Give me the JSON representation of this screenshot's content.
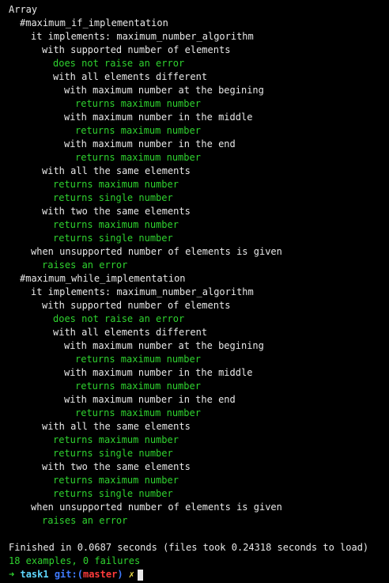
{
  "colors": {
    "background": "#000000",
    "text": "#e8e8e8",
    "pass": "#2fd32f",
    "prompt_dir": "#5fd7ff",
    "prompt_git": "#3f7bff",
    "prompt_branch": "#ff3b3b",
    "prompt_dirty": "#f2e24b"
  },
  "output": {
    "lines": [
      {
        "text": "Array",
        "indent": 0,
        "status": "group"
      },
      {
        "text": "#maximum_if_implementation",
        "indent": 1,
        "status": "group"
      },
      {
        "text": "it implements: maximum_number_algorithm",
        "indent": 2,
        "status": "group"
      },
      {
        "text": "with supported number of elements",
        "indent": 3,
        "status": "group"
      },
      {
        "text": "does not raise an error",
        "indent": 4,
        "status": "passed"
      },
      {
        "text": "with all elements different",
        "indent": 4,
        "status": "group"
      },
      {
        "text": "with maximum number at the begining",
        "indent": 5,
        "status": "group"
      },
      {
        "text": "returns maximum number",
        "indent": 6,
        "status": "passed"
      },
      {
        "text": "with maximum number in the middle",
        "indent": 5,
        "status": "group"
      },
      {
        "text": "returns maximum number",
        "indent": 6,
        "status": "passed"
      },
      {
        "text": "with maximum number in the end",
        "indent": 5,
        "status": "group"
      },
      {
        "text": "returns maximum number",
        "indent": 6,
        "status": "passed"
      },
      {
        "text": "with all the same elements",
        "indent": 3,
        "status": "group"
      },
      {
        "text": "returns maximum number",
        "indent": 4,
        "status": "passed"
      },
      {
        "text": "returns single number",
        "indent": 4,
        "status": "passed"
      },
      {
        "text": "with two the same elements",
        "indent": 3,
        "status": "group"
      },
      {
        "text": "returns maximum number",
        "indent": 4,
        "status": "passed"
      },
      {
        "text": "returns single number",
        "indent": 4,
        "status": "passed"
      },
      {
        "text": "when unsupported number of elements is given",
        "indent": 2,
        "status": "group"
      },
      {
        "text": "raises an error",
        "indent": 3,
        "status": "passed"
      },
      {
        "text": "#maximum_while_implementation",
        "indent": 1,
        "status": "group"
      },
      {
        "text": "it implements: maximum_number_algorithm",
        "indent": 2,
        "status": "group"
      },
      {
        "text": "with supported number of elements",
        "indent": 3,
        "status": "group"
      },
      {
        "text": "does not raise an error",
        "indent": 4,
        "status": "passed"
      },
      {
        "text": "with all elements different",
        "indent": 4,
        "status": "group"
      },
      {
        "text": "with maximum number at the begining",
        "indent": 5,
        "status": "group"
      },
      {
        "text": "returns maximum number",
        "indent": 6,
        "status": "passed"
      },
      {
        "text": "with maximum number in the middle",
        "indent": 5,
        "status": "group"
      },
      {
        "text": "returns maximum number",
        "indent": 6,
        "status": "passed"
      },
      {
        "text": "with maximum number in the end",
        "indent": 5,
        "status": "group"
      },
      {
        "text": "returns maximum number",
        "indent": 6,
        "status": "passed"
      },
      {
        "text": "with all the same elements",
        "indent": 3,
        "status": "group"
      },
      {
        "text": "returns maximum number",
        "indent": 4,
        "status": "passed"
      },
      {
        "text": "returns single number",
        "indent": 4,
        "status": "passed"
      },
      {
        "text": "with two the same elements",
        "indent": 3,
        "status": "group"
      },
      {
        "text": "returns maximum number",
        "indent": 4,
        "status": "passed"
      },
      {
        "text": "returns single number",
        "indent": 4,
        "status": "passed"
      },
      {
        "text": "when unsupported number of elements is given",
        "indent": 2,
        "status": "group"
      },
      {
        "text": "raises an error",
        "indent": 3,
        "status": "passed"
      }
    ]
  },
  "summary": {
    "finished": "Finished in 0.0687 seconds (files took 0.24318 seconds to load)",
    "result": "18 examples, 0 failures"
  },
  "prompt": {
    "arrow": "➜",
    "directory": "task1",
    "git_label": "git:",
    "paren_open": "(",
    "branch": "master",
    "paren_close": ")",
    "dirty_marker": "✗"
  }
}
